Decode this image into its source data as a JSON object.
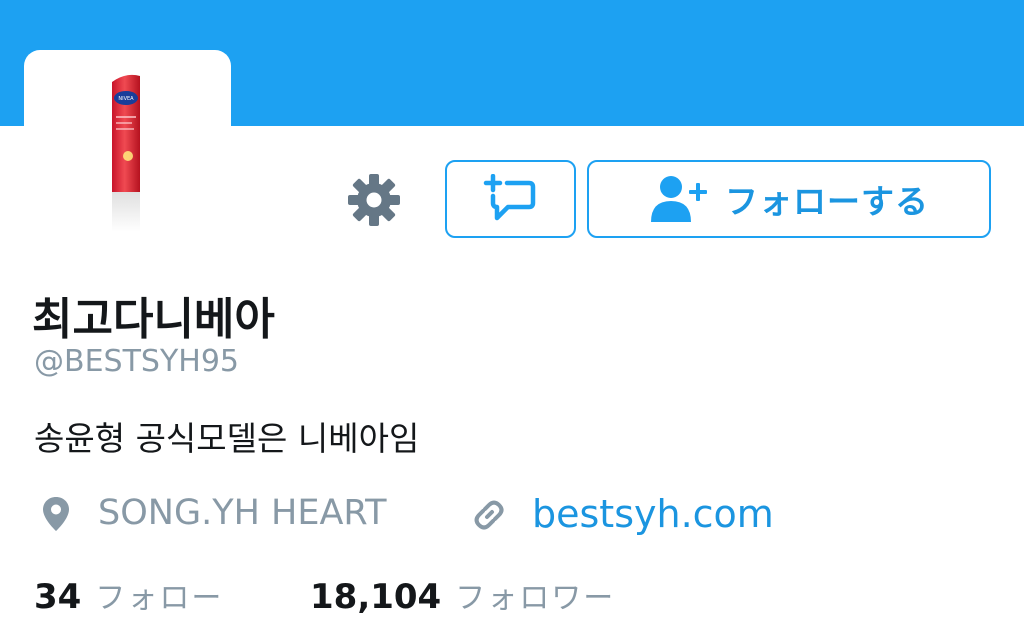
{
  "profile": {
    "name": "최고다니베아",
    "handle": "@BESTSYH95",
    "bio": "송윤형 공식모델은 니베아임",
    "location": "SONG.YH HEART",
    "website": "bestsyh.com",
    "avatar_brand": "NIVEA"
  },
  "actions": {
    "follow_label": "フォローする"
  },
  "stats": {
    "following_count": "34",
    "following_label": "フォロー",
    "followers_count": "18,104",
    "followers_label": "フォロワー"
  },
  "icons": [
    "gear-icon",
    "message-icon",
    "follow-person-icon",
    "location-pin-icon",
    "link-icon"
  ],
  "colors": {
    "accent": "#1da1f2",
    "link": "#1b95e0",
    "muted": "#8899a6",
    "text": "#14171a"
  }
}
